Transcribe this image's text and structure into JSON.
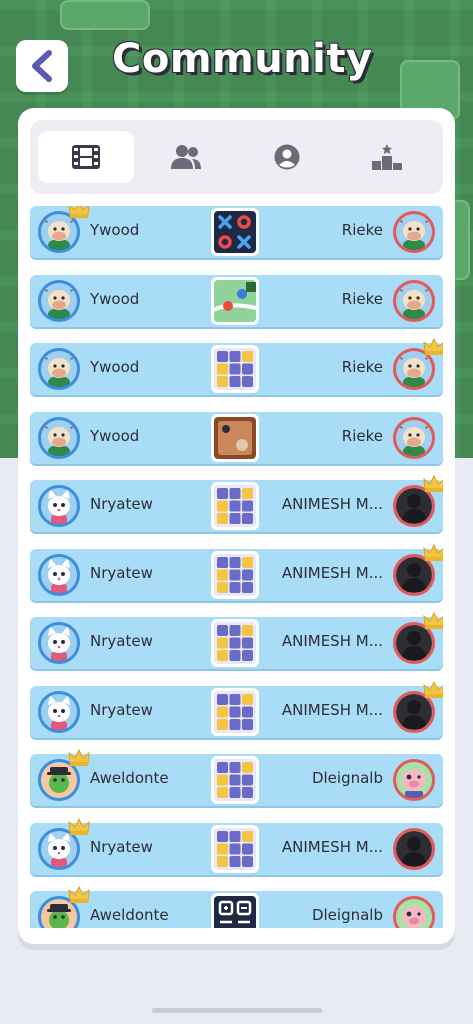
{
  "header": {
    "title": "Community",
    "back_icon": "chevron-left-icon"
  },
  "tabs": [
    {
      "id": "matches",
      "icon": "film-icon",
      "active": true
    },
    {
      "id": "friends",
      "icon": "users-icon",
      "active": false
    },
    {
      "id": "profile",
      "icon": "user-circle-icon",
      "active": false
    },
    {
      "id": "leaderboard",
      "icon": "podium-icon",
      "active": false
    }
  ],
  "matches": [
    {
      "left": {
        "name": "Ywood",
        "avatar": "cow",
        "crown": true
      },
      "game": "tic-tac-toe",
      "right": {
        "name": "Rieke",
        "avatar": "cow",
        "crown": false
      }
    },
    {
      "left": {
        "name": "Ywood",
        "avatar": "cow",
        "crown": false
      },
      "game": "map-game",
      "right": {
        "name": "Rieke",
        "avatar": "cow",
        "crown": false
      }
    },
    {
      "left": {
        "name": "Ywood",
        "avatar": "cow",
        "crown": false
      },
      "game": "memory-grid",
      "right": {
        "name": "Rieke",
        "avatar": "cow",
        "crown": true
      }
    },
    {
      "left": {
        "name": "Ywood",
        "avatar": "cow",
        "crown": false
      },
      "game": "board-game",
      "right": {
        "name": "Rieke",
        "avatar": "cow",
        "crown": false
      }
    },
    {
      "left": {
        "name": "Nryatew",
        "avatar": "cat",
        "crown": false
      },
      "game": "memory-grid",
      "right": {
        "name": "ANIMESH M...",
        "avatar": "silhouette",
        "crown": true
      }
    },
    {
      "left": {
        "name": "Nryatew",
        "avatar": "cat",
        "crown": false
      },
      "game": "memory-grid",
      "right": {
        "name": "ANIMESH M...",
        "avatar": "silhouette",
        "crown": true
      }
    },
    {
      "left": {
        "name": "Nryatew",
        "avatar": "cat",
        "crown": false
      },
      "game": "memory-grid",
      "right": {
        "name": "ANIMESH M...",
        "avatar": "silhouette",
        "crown": true
      }
    },
    {
      "left": {
        "name": "Nryatew",
        "avatar": "cat",
        "crown": false
      },
      "game": "memory-grid",
      "right": {
        "name": "ANIMESH M...",
        "avatar": "silhouette",
        "crown": true
      }
    },
    {
      "left": {
        "name": "Aweldonte",
        "avatar": "croc",
        "crown": true
      },
      "game": "memory-grid",
      "right": {
        "name": "Dleignalb",
        "avatar": "pig",
        "crown": false
      }
    },
    {
      "left": {
        "name": "Nryatew",
        "avatar": "cat",
        "crown": true
      },
      "game": "memory-grid",
      "right": {
        "name": "ANIMESH M...",
        "avatar": "silhouette",
        "crown": false
      }
    },
    {
      "left": {
        "name": "Aweldonte",
        "avatar": "croc",
        "crown": true
      },
      "game": "calculator",
      "right": {
        "name": "Dleignalb",
        "avatar": "pig",
        "crown": false
      }
    }
  ],
  "colors": {
    "header_green": "#4e9a5e",
    "row_blue": "#a9dcf7",
    "left_ring": "#3b8ee0",
    "right_ring": "#e45a5a",
    "crown": "#f5c542"
  }
}
